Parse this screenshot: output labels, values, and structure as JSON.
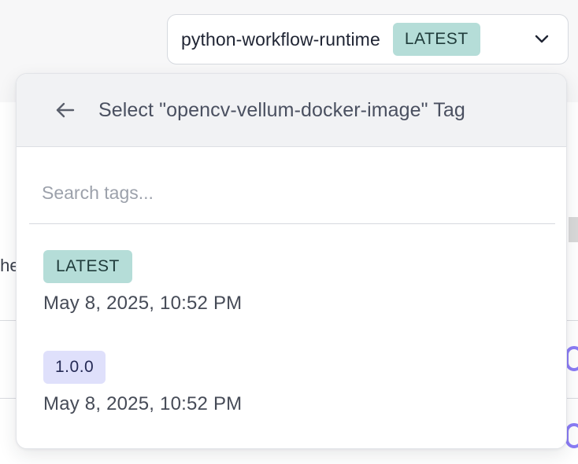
{
  "runtime_select": {
    "name": "python-workflow-runtime",
    "tag": "LATEST"
  },
  "background": {
    "cut_text": "the"
  },
  "dropdown": {
    "title": "Select \"opencv-vellum-docker-image\" Tag",
    "search": {
      "placeholder": "Search tags...",
      "value": ""
    },
    "tags": [
      {
        "label": "LATEST",
        "date": "May 8, 2025, 10:52 PM"
      },
      {
        "label": "1.0.0",
        "date": "May 8, 2025, 10:52 PM"
      }
    ]
  },
  "colors": {
    "latest_badge": "#b5ddd8",
    "version_badge": "#dfe0fb",
    "accent_ring": "#8b7cf6"
  },
  "icons": {
    "back": "arrow-left-icon",
    "expand": "chevron-down-icon"
  }
}
